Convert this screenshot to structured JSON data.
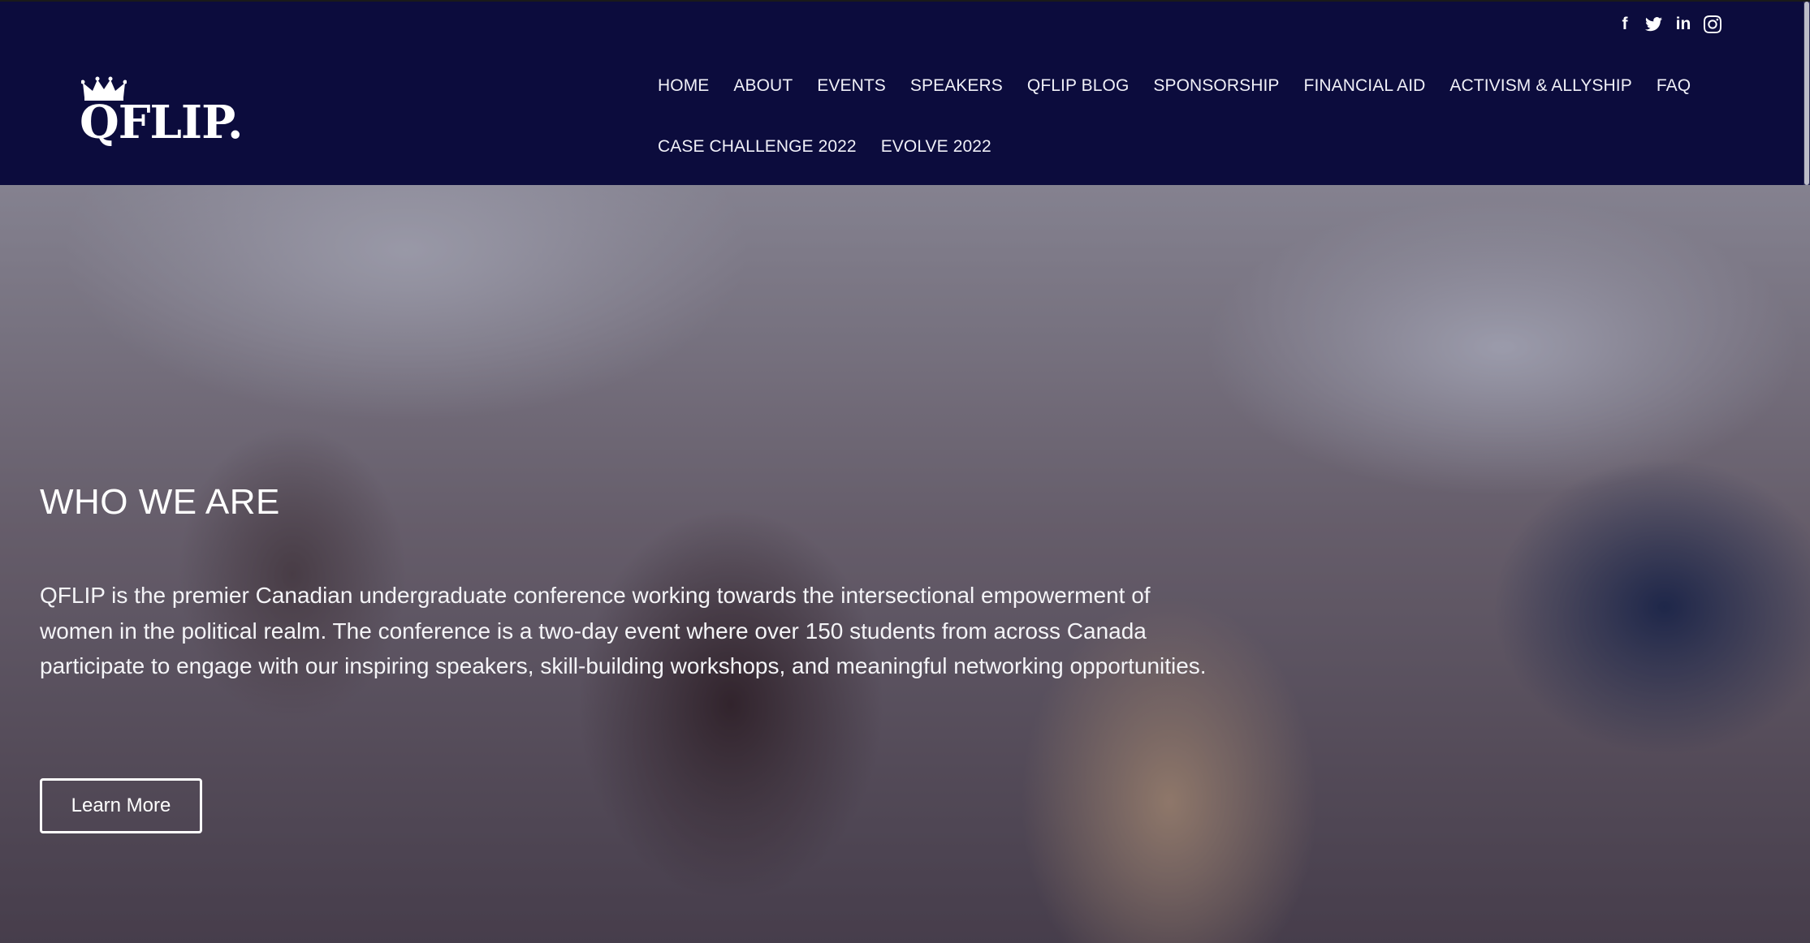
{
  "brand": {
    "logo_text": "QFLIP."
  },
  "social": {
    "facebook": "f",
    "twitter_icon": "twitter-icon",
    "linkedin": "in",
    "instagram_icon": "instagram-icon"
  },
  "nav": {
    "row1": [
      "HOME",
      "ABOUT",
      "EVENTS",
      "SPEAKERS",
      "QFLIP BLOG",
      "SPONSORSHIP",
      "FINANCIAL AID",
      "ACTIVISM & ALLYSHIP",
      "FAQ"
    ],
    "row2": [
      "CASE CHALLENGE 2022",
      "EVOLVE 2022"
    ]
  },
  "hero": {
    "title": "WHO WE ARE",
    "description": "QFLIP is the premier Canadian undergraduate conference working towards the intersectional empowerment of women in the political realm. The conference is a two-day event where over 150 students from across Canada participate to engage with our inspiring speakers, skill-building workshops, and meaningful networking opportunities.",
    "button_label": "Learn More"
  },
  "colors": {
    "header_bg": "#0c0c3d",
    "text": "#ffffff"
  }
}
